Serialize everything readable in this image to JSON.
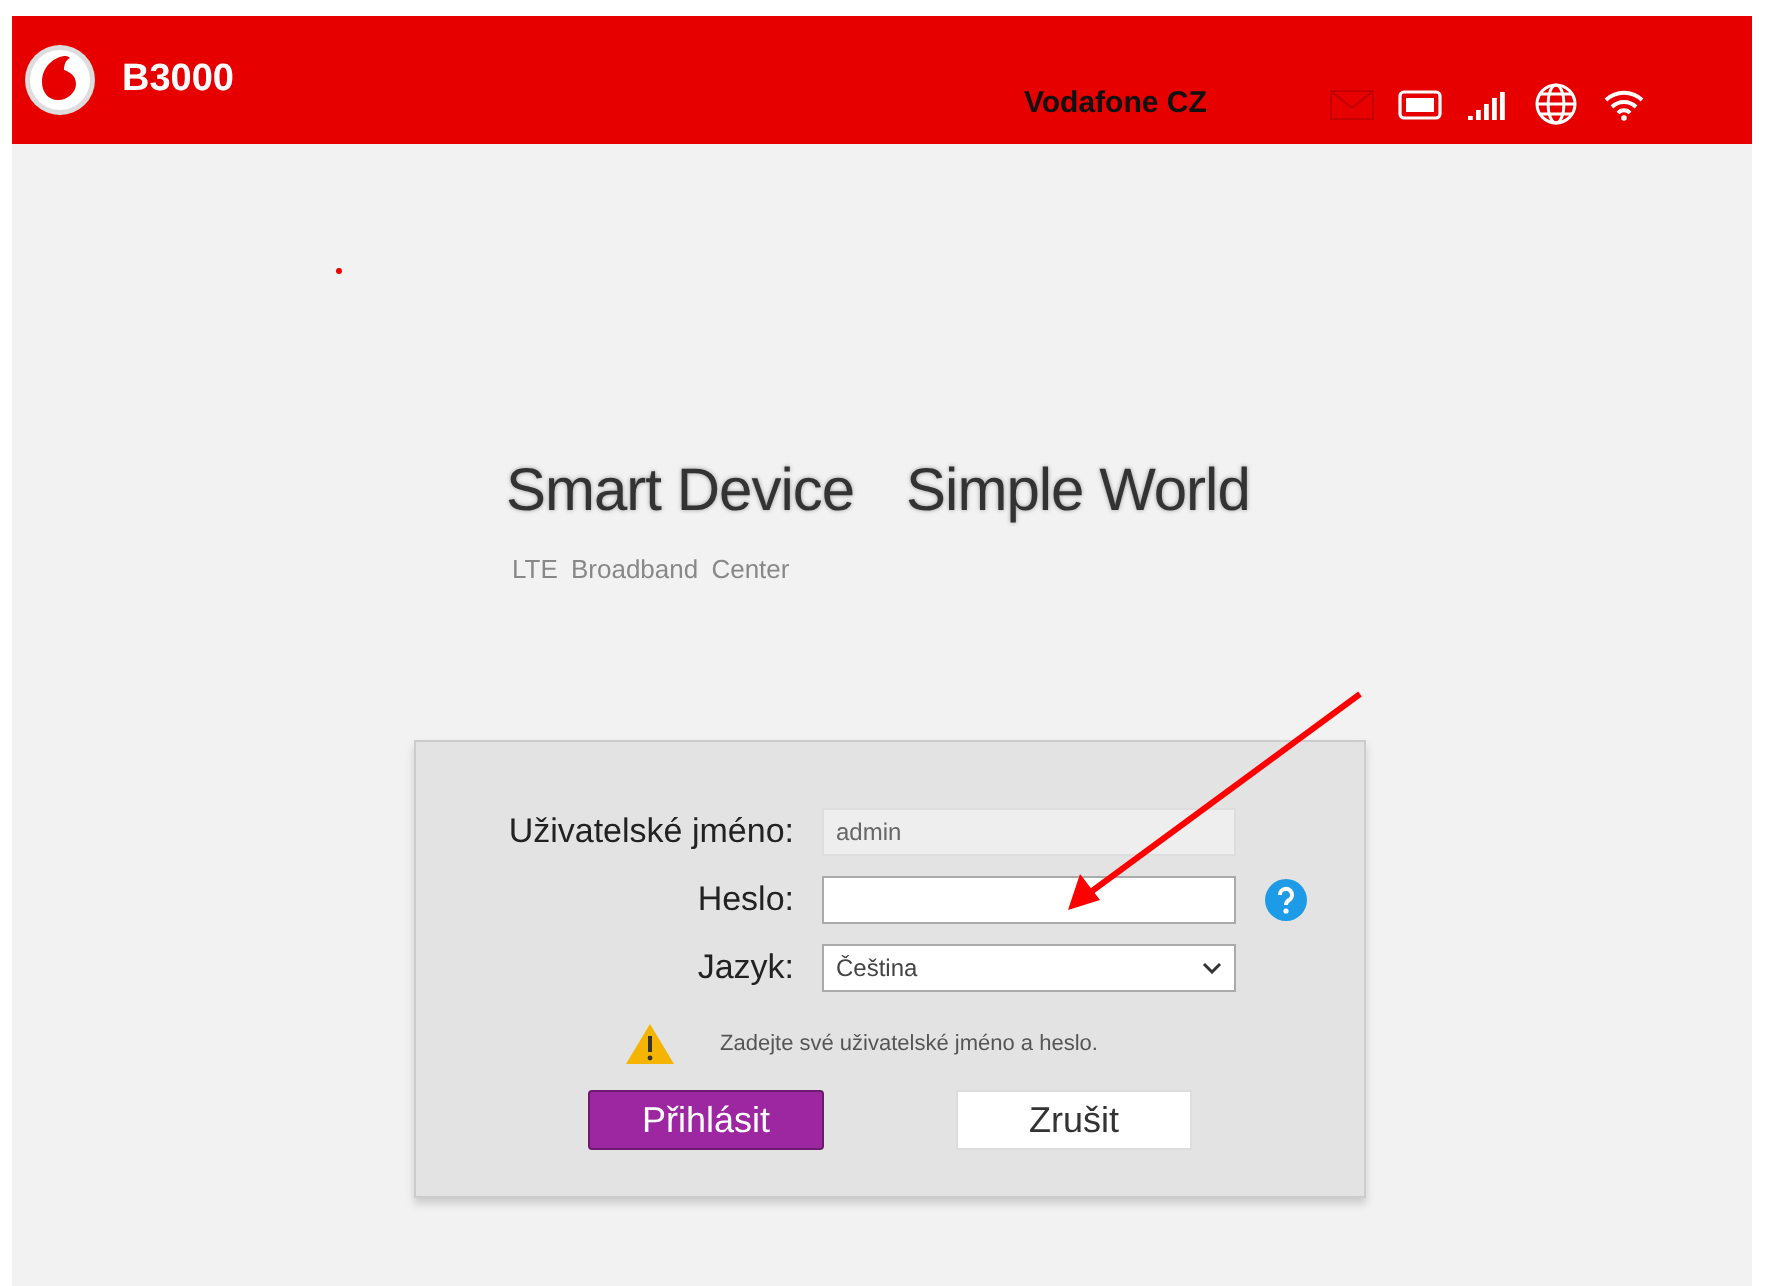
{
  "header": {
    "model": "B3000",
    "operator": "Vodafone CZ"
  },
  "hero": {
    "slogan_left": "Smart Device",
    "slogan_right": "Simple World",
    "subtitle": "LTE Broadband Center"
  },
  "login": {
    "fields": [
      {
        "kind": "text",
        "label": "Uživatelské jméno:",
        "value": "admin",
        "disabled": true
      },
      {
        "kind": "password",
        "label": "Heslo:",
        "disabled": false,
        "help": true
      },
      {
        "kind": "select",
        "label": "Jazyk:",
        "value": "Čeština",
        "disabled": false
      }
    ],
    "message": "Zadejte své uživatelské jméno a heslo.",
    "buttons": [
      {
        "kind": "primary",
        "label": "Přihlásit"
      },
      {
        "kind": "secondary",
        "label": "Zrušit"
      }
    ]
  }
}
